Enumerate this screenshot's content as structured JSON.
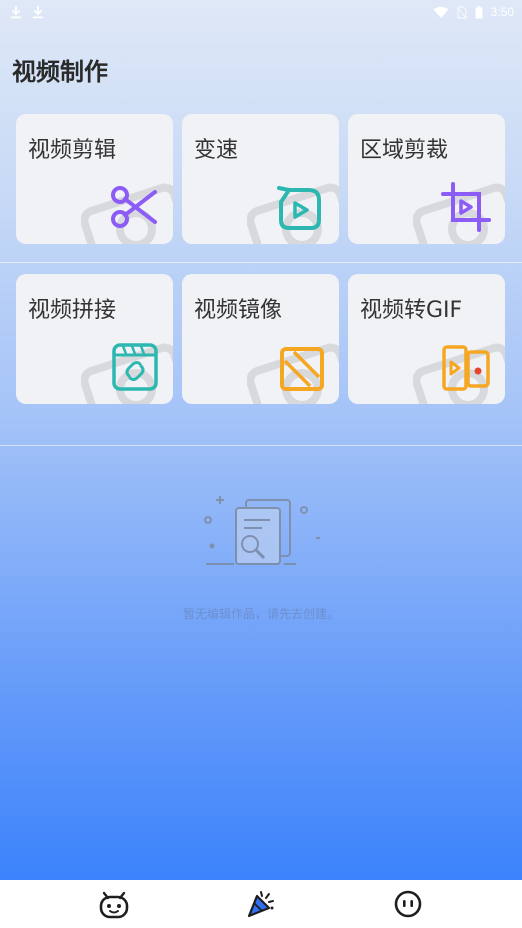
{
  "status_bar": {
    "time": "3:50",
    "left_icons": [
      "download-icon",
      "download-icon"
    ],
    "right_icons": [
      "wifi-icon",
      "no-sim-icon",
      "battery-icon"
    ]
  },
  "page_title": "视频制作",
  "tools": [
    {
      "label": "视频剪辑",
      "icon": "scissors-icon",
      "color": "#8b5cf6"
    },
    {
      "label": "变速",
      "icon": "speed-play-icon",
      "color": "#2cb8b0"
    },
    {
      "label": "区域剪裁",
      "icon": "crop-icon",
      "color": "#8b5cf6"
    },
    {
      "label": "视频拼接",
      "icon": "link-film-icon",
      "color": "#2cb8b0"
    },
    {
      "label": "视频镜像",
      "icon": "mirror-icon",
      "color": "#f5a623"
    },
    {
      "label": "视频转GIF",
      "icon": "video-gif-icon",
      "color": "#f5a623"
    }
  ],
  "empty_state": {
    "icon": "empty-documents-icon",
    "text": "暂无编辑作品，请先去创建。"
  },
  "bottom_nav": [
    {
      "name": "android-tab",
      "icon": "android-face-icon",
      "active": false
    },
    {
      "name": "party-tab",
      "icon": "party-popper-icon",
      "active": true
    },
    {
      "name": "face-tab",
      "icon": "face-icon",
      "active": false
    }
  ],
  "colors": {
    "accent_purple": "#8b5cf6",
    "accent_teal": "#2cb8b0",
    "accent_orange": "#f5a623",
    "nav_active": "#2f6ff0"
  }
}
